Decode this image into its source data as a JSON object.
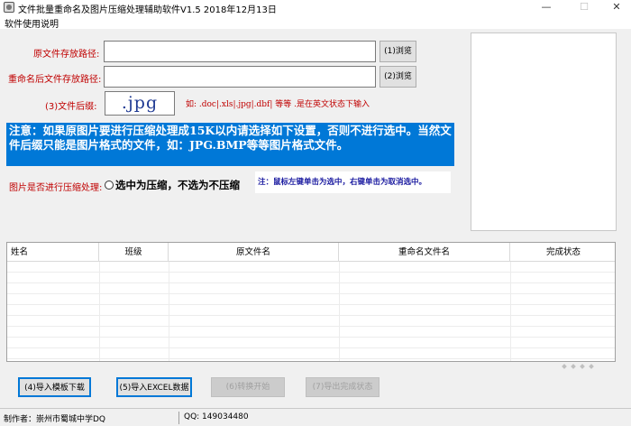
{
  "window": {
    "title": "文件批量重命名及图片压缩处理辅助软件V1.5  2018年12月13日",
    "min_glyph": "—",
    "max_glyph": "☐",
    "close_glyph": "✕"
  },
  "menu": {
    "items": [
      {
        "label": "软件使用说明"
      }
    ]
  },
  "form": {
    "source_path": {
      "label": "原文件存放路径:",
      "value": "",
      "browse": "(1)浏览"
    },
    "rename_path": {
      "label": "重命名后文件存放路径:",
      "value": "",
      "browse": "(2)浏览"
    },
    "extension": {
      "label": "(3)文件后缀:",
      "value": ".jpg",
      "hint": "如: .doc|.xls|.jpg|.dbf|  等等   .是在英文状态下输入"
    },
    "notice": "      注意：如果原图片要进行压缩处理成15K以内请选择如下设置，否则不进行选中。当然文件后缀只能是图片格式的文件，如：JPG.BMP等等图片格式文件。",
    "compress": {
      "label": "图片是否进行压缩处理:",
      "option": "选中为压缩，不选为不压缩",
      "checked": false,
      "note": "注：鼠标左键单击为选中，右键单击为取消选中。"
    }
  },
  "table": {
    "columns": [
      "姓名",
      "班级",
      "原文件名",
      "重命名文件名",
      "完成状态"
    ],
    "rows": []
  },
  "buttons": {
    "import_template": "(4)导入模板下载",
    "import_excel": "(5)导入EXCEL数据",
    "convert": "(6)转换开始",
    "export_status": "(7)导出完成状态"
  },
  "status": {
    "author": "制作者：崇州市蜀城中学DQ",
    "qq": "QQ: 149034480"
  },
  "colors": {
    "label_red": "#c00000",
    "notice_bg": "#0078d7",
    "note_blue": "#1a1aa0",
    "button_focus_border": "#0078d7",
    "disabled_text": "#a0a0a0"
  }
}
